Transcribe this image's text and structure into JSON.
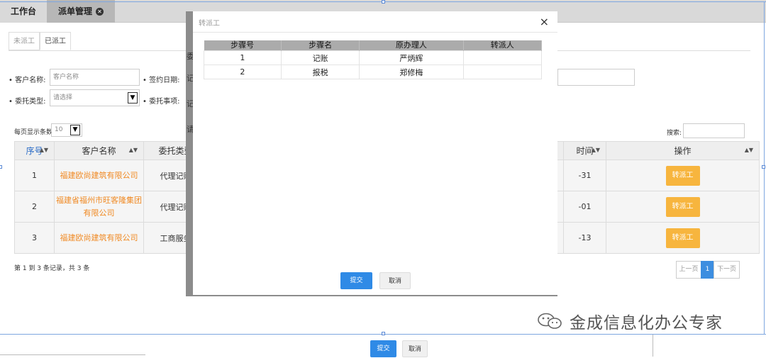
{
  "tabs": {
    "workbench": "工作台",
    "dispatch": "派单管理",
    "close_icon": "✕"
  },
  "subtabs": {
    "undispatched": "未派工",
    "dispatched": "已派工"
  },
  "filters": {
    "customer_label": "客户名称:",
    "customer_placeholder": "客户名称",
    "sign_date_label": "签约日期:",
    "entrust_type_label": "委托类型:",
    "entrust_type_value": "请选择",
    "entrust_item_label": "委托事项:"
  },
  "page_size": {
    "label": "每页显示条数:",
    "value": "10"
  },
  "search_label": "搜索:",
  "table": {
    "headers": {
      "seq": "序号",
      "customer": "客户名称",
      "type": "委托类型",
      "time": "时间",
      "op": "操作"
    },
    "rows": [
      {
        "seq": "1",
        "customer": "福建欧尚建筑有限公司",
        "type": "代理记账",
        "time": "-31",
        "action": "转派工"
      },
      {
        "seq": "2",
        "customer": "福建省福州市旺客隆集团有限公司",
        "type": "代理记账",
        "time": "-01",
        "action": "转派工"
      },
      {
        "seq": "3",
        "customer": "福建欧尚建筑有限公司",
        "type": "工商服务",
        "time": "-13",
        "action": "转派工"
      }
    ]
  },
  "record_summary": "第 1 到 3 条记录，共 3 条",
  "pager": {
    "prev": "上一页",
    "current": "1",
    "next": "下一页"
  },
  "behind_modal_fragments": [
    "委",
    "记",
    "记",
    "请"
  ],
  "bottom_buttons": {
    "submit": "提交",
    "cancel": "取消"
  },
  "modal": {
    "title": "转派工",
    "close": "×",
    "headers": [
      "步骤号",
      "步骤名",
      "原办理人",
      "转派人"
    ],
    "rows": [
      {
        "step": "1",
        "name": "记账",
        "handler": "严炳辉",
        "transfer": ""
      },
      {
        "step": "2",
        "name": "报税",
        "handler": "郑修梅",
        "transfer": ""
      }
    ],
    "submit": "提交",
    "cancel": "取消"
  },
  "watermark": "金成信息化办公专家",
  "colors": {
    "accent_orange": "#f7b53e",
    "company_link": "#f08a24",
    "primary_blue": "#2f8ae6"
  }
}
